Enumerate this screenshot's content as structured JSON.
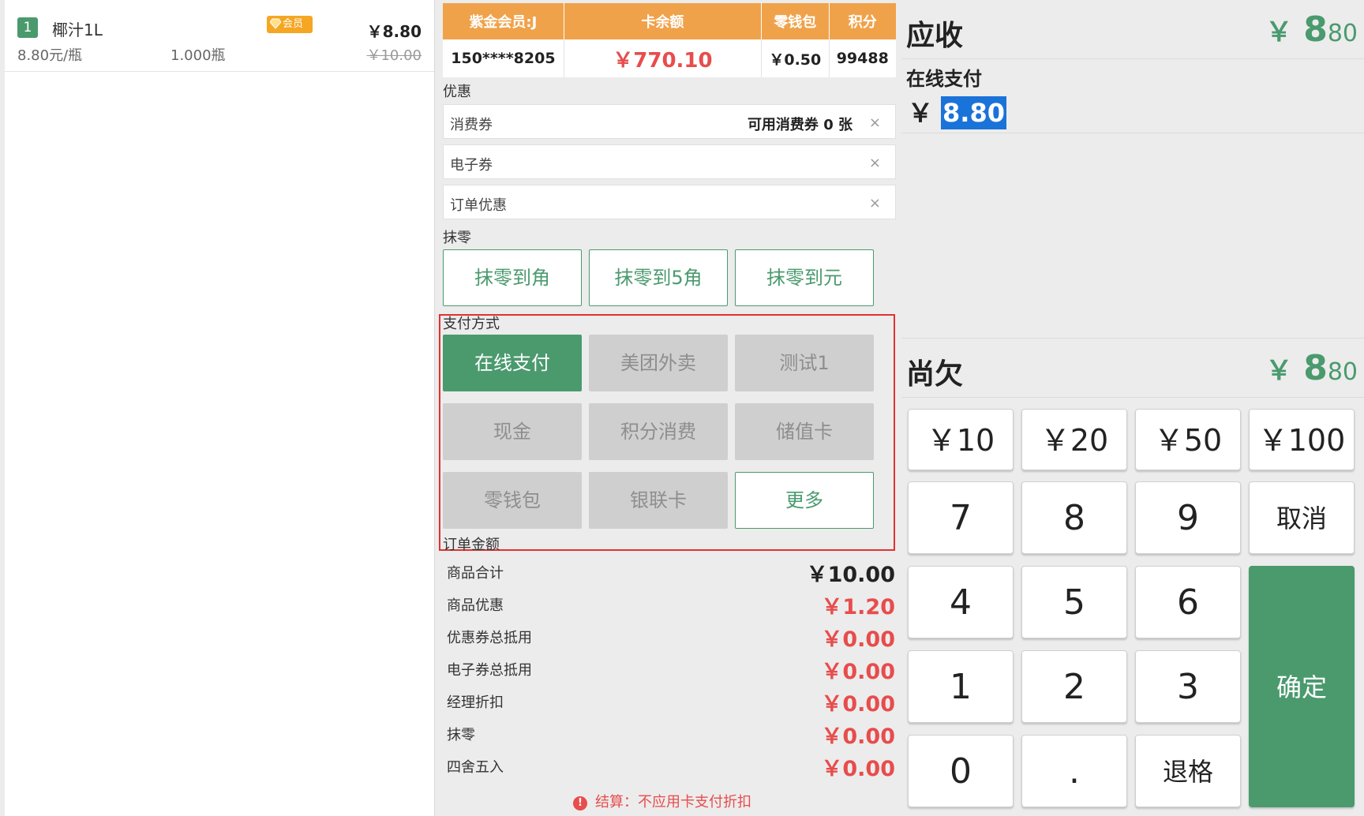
{
  "order_items": [
    {
      "index": "1",
      "name": "椰汁1L",
      "member_tag": "会员",
      "price": "￥8.80",
      "unit_price": "8.80元/瓶",
      "quantity": "1.000瓶",
      "original_price": "￥10.00"
    }
  ],
  "member": {
    "headers": [
      "紫金会员:J",
      "卡余额",
      "零钱包",
      "积分"
    ],
    "phone": "150****8205",
    "balance": "￥770.10",
    "wallet": "￥0.50",
    "points": "99488"
  },
  "discount": {
    "section_label": "优惠",
    "rows": [
      {
        "label": "消费券",
        "info": "可用消费券 0 张",
        "close": "×"
      },
      {
        "label": "电子券",
        "info": "",
        "close": "×"
      },
      {
        "label": "订单优惠",
        "info": "",
        "close": "×"
      }
    ]
  },
  "rounding": {
    "section_label": "抹零",
    "buttons": [
      "抹零到角",
      "抹零到5角",
      "抹零到元"
    ]
  },
  "payment": {
    "section_label": "支付方式",
    "methods": [
      {
        "label": "在线支付",
        "state": "active"
      },
      {
        "label": "美团外卖",
        "state": "disabled"
      },
      {
        "label": "测试1",
        "state": "disabled"
      },
      {
        "label": "现金",
        "state": "disabled"
      },
      {
        "label": "积分消费",
        "state": "disabled"
      },
      {
        "label": "储值卡",
        "state": "disabled"
      },
      {
        "label": "零钱包",
        "state": "disabled"
      },
      {
        "label": "银联卡",
        "state": "disabled"
      },
      {
        "label": "更多",
        "state": "outline"
      }
    ]
  },
  "order_amount": {
    "section_label": "订单金额",
    "rows": [
      {
        "label": "商品合计",
        "value": "￥10.00"
      },
      {
        "label": "商品优惠",
        "value": "￥1.20"
      },
      {
        "label": "优惠券总抵用",
        "value": "￥0.00"
      },
      {
        "label": "电子券总抵用",
        "value": "￥0.00"
      },
      {
        "label": "经理折扣",
        "value": "￥0.00"
      },
      {
        "label": "抹零",
        "value": "￥0.00"
      },
      {
        "label": "四舍五入",
        "value": "￥0.00"
      }
    ],
    "settle_note": "结算：不应用卡支付折扣",
    "alert_glyph": "!"
  },
  "receivable": {
    "title": "应收",
    "yen": "￥",
    "integer": "8",
    "decimal": "80"
  },
  "online_pay": {
    "label": "在线支付",
    "yen": "￥",
    "value": "8.80"
  },
  "owed": {
    "title": "尚欠",
    "yen": "￥",
    "integer": "8",
    "decimal": "80"
  },
  "keypad": {
    "quick": [
      "￥10",
      "￥20",
      "￥50",
      "￥100"
    ],
    "digits": [
      "7",
      "8",
      "9",
      "4",
      "5",
      "6",
      "1",
      "2",
      "3",
      "0",
      "."
    ],
    "cancel": "取消",
    "confirm": "确定",
    "backspace": "退格"
  },
  "colors": {
    "accent_green": "#4a9a6e",
    "header_orange": "#f0a24a",
    "alert_red": "#e84c4c",
    "selection_blue": "#1a73d9"
  }
}
